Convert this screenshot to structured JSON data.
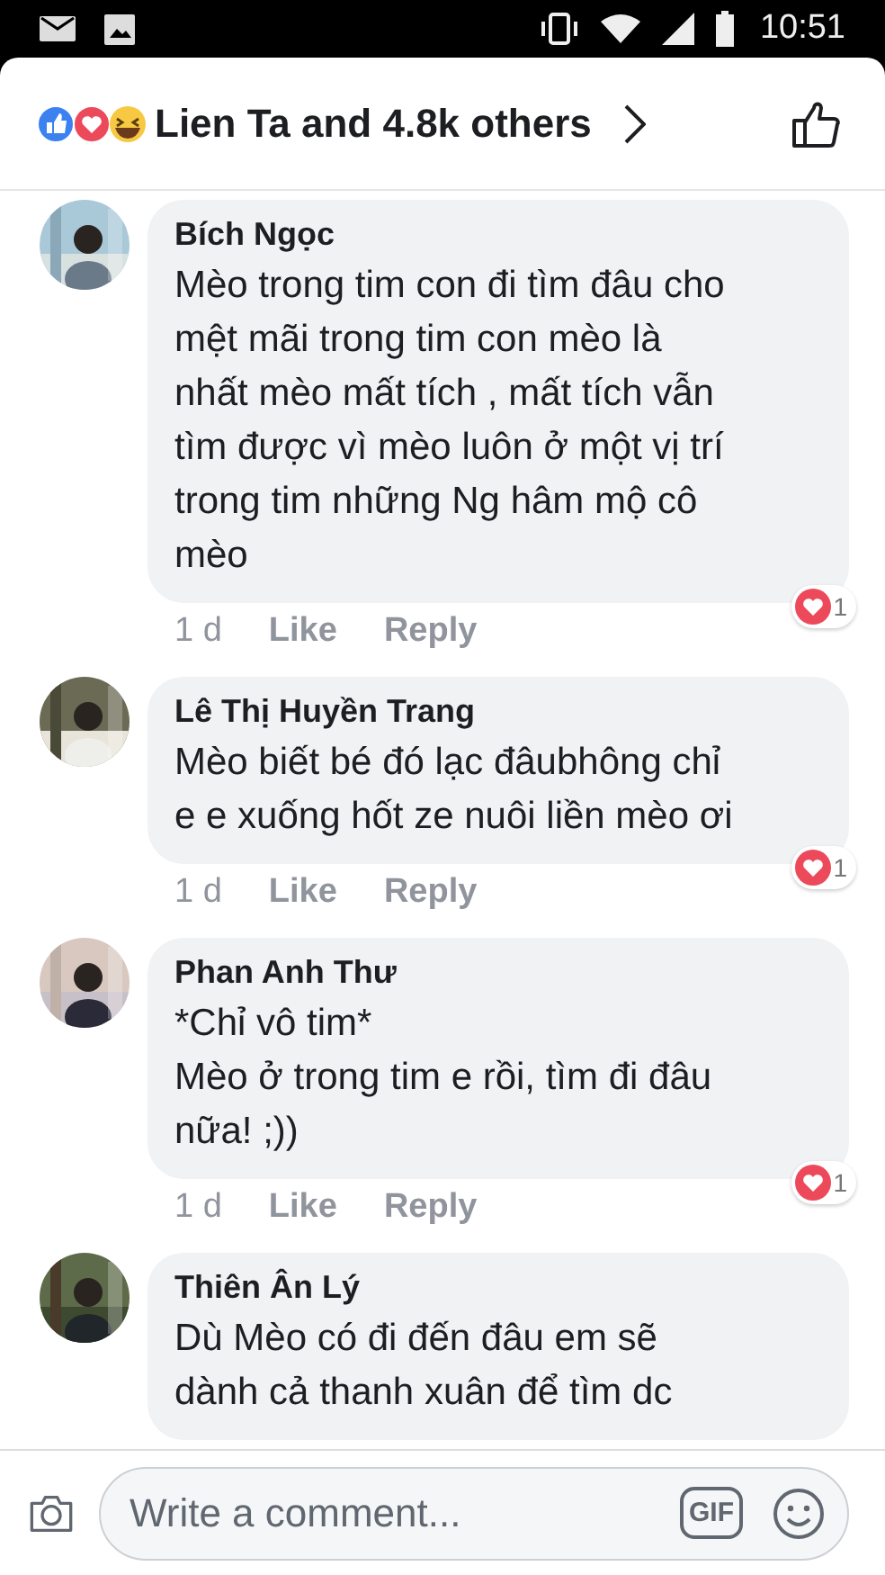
{
  "status_bar": {
    "time": "10:51"
  },
  "header": {
    "reactions_summary": "Lien Ta and 4.8k others"
  },
  "comments": [
    {
      "author": "Bích Ngọc",
      "text": "Mèo trong tim con đi tìm đâu cho\nmệt mãi trong tim con mèo là\nnhất mèo mất tích , mất tích vẫn\ntìm được vì mèo luôn ở một vị trí\ntrong tim những Ng hâm mộ cô\nmèo",
      "time": "1 d",
      "like": "Like",
      "reply": "Reply",
      "reaction_count": "1"
    },
    {
      "author": "Lê Thị Huyền Trang",
      "text": "Mèo biết bé đó lạc đâubhông chỉ\ne e xuống hốt ze nuôi liền mèo ơi",
      "time": "1 d",
      "like": "Like",
      "reply": "Reply",
      "reaction_count": "1"
    },
    {
      "author": "Phan Anh Thư",
      "text": "*Chỉ vô tim*\nMèo ở trong tim e rồi, tìm đi đâu\nnữa! ;))",
      "time": "1 d",
      "like": "Like",
      "reply": "Reply",
      "reaction_count": "1"
    },
    {
      "author": "Thiên Ân Lý",
      "text": "Dù Mèo có đi đến đâu em sẽ\ndành cả thanh xuân để tìm dc"
    }
  ],
  "composer": {
    "placeholder": "Write a comment...",
    "gif_label": "GIF"
  }
}
